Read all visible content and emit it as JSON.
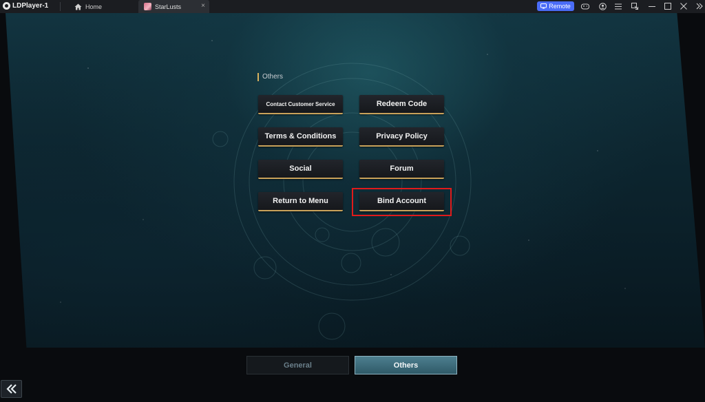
{
  "window": {
    "app_title": "LDPlayer-1",
    "home_tab_label": "Home",
    "game_tab_label": "StarLusts",
    "close_glyph": "×",
    "remote_label": "Remote"
  },
  "titlebar_icons": [
    "gamepad-icon",
    "account-icon",
    "menu-icon",
    "restore-icon",
    "minimize-icon",
    "maximize-icon",
    "close-icon",
    "collapse-icon"
  ],
  "settings": {
    "section_title": "Others",
    "buttons": {
      "contact": "Contact Customer Service",
      "redeem": "Redeem Code",
      "terms": "Terms & Conditions",
      "privacy": "Privacy Policy",
      "social": "Social",
      "forum": "Forum",
      "return_menu": "Return to Menu",
      "bind": "Bind Account"
    }
  },
  "bottom_tabs": {
    "general": "General",
    "others": "Others",
    "active": "Others"
  },
  "back_glyph": "《",
  "colors": {
    "accent_gold": "#c9a25a",
    "highlight_red": "#e01b1b",
    "active_tab": "#3d6f7f",
    "remote_blue": "#4a6cf7"
  }
}
